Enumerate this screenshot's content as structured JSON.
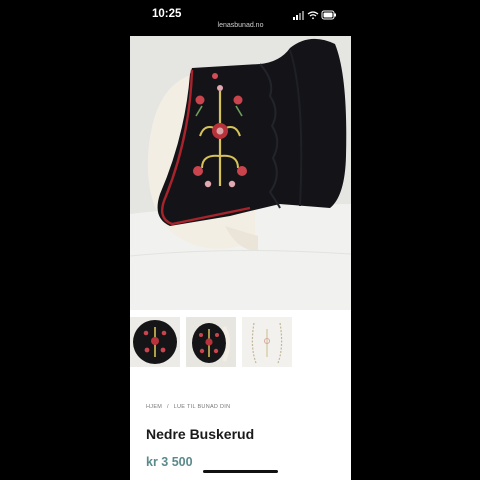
{
  "status_bar": {
    "time": "10:25"
  },
  "browser": {
    "url": "lenasbunad.no"
  },
  "product": {
    "images": {
      "main_alt": "Black embroidered bunad bonnet with red piping on mannequin",
      "thumbnails": [
        "bonnet-front",
        "bonnet-front-alt",
        "bonnet-outline"
      ]
    },
    "breadcrumb": {
      "home": "HJEM",
      "separator": "/",
      "category": "LUE TIL BUNAD DIN"
    },
    "title": "Nedre Buskerud",
    "price": "kr 3 500"
  },
  "colors": {
    "fabric": "#141418",
    "piping": "#a8232b",
    "price_accent": "#5a8a8c"
  }
}
